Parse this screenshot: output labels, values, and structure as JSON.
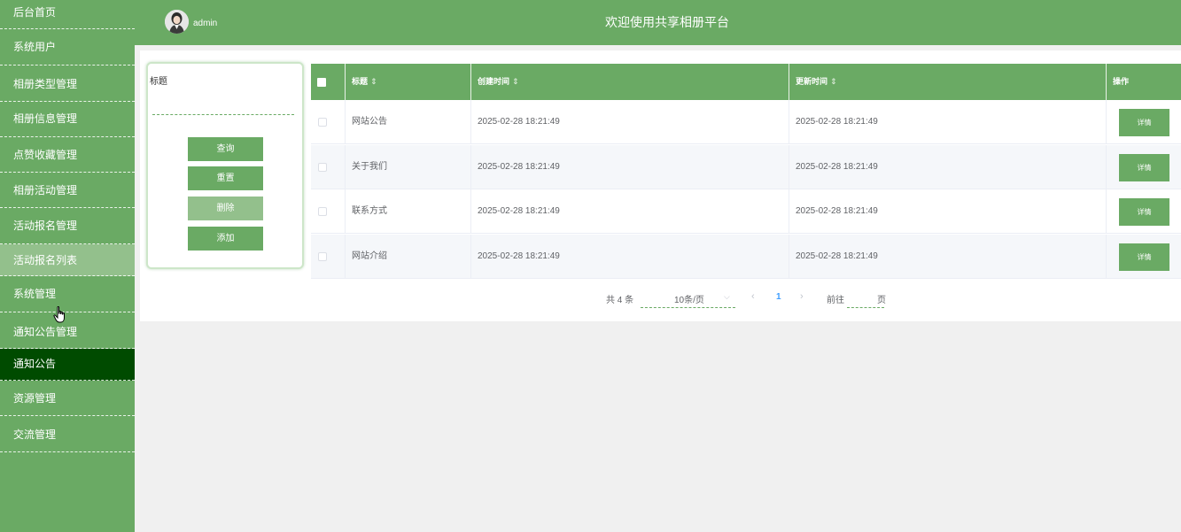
{
  "sidebar": {
    "items": [
      {
        "label": "后台首页"
      },
      {
        "label": "系统用户"
      },
      {
        "label": "相册类型管理"
      },
      {
        "label": "相册信息管理"
      },
      {
        "label": "点赞收藏管理"
      },
      {
        "label": "相册活动管理"
      },
      {
        "label": "活动报名管理"
      },
      {
        "label": "活动报名列表"
      },
      {
        "label": "系统管理"
      },
      {
        "label": "通知公告管理"
      },
      {
        "label": "通知公告"
      },
      {
        "label": "资源管理"
      },
      {
        "label": "交流管理"
      }
    ]
  },
  "header": {
    "username": "admin",
    "title": "欢迎使用共享相册平台"
  },
  "search": {
    "label": "标题",
    "value": "",
    "query_label": "查询",
    "reset_label": "重置",
    "delete_label": "删除",
    "add_label": "添加"
  },
  "table": {
    "columns": {
      "title": "标题",
      "created": "创建时间",
      "updated": "更新时间",
      "action": "操作"
    },
    "sort_icon": "⇕",
    "rows": [
      {
        "title": "网站公告",
        "created": "2025-02-28 18:21:49",
        "updated": "2025-02-28 18:21:49",
        "action": "详情"
      },
      {
        "title": "关于我们",
        "created": "2025-02-28 18:21:49",
        "updated": "2025-02-28 18:21:49",
        "action": "详情"
      },
      {
        "title": "联系方式",
        "created": "2025-02-28 18:21:49",
        "updated": "2025-02-28 18:21:49",
        "action": "详情"
      },
      {
        "title": "网站介绍",
        "created": "2025-02-28 18:21:49",
        "updated": "2025-02-28 18:21:49",
        "action": "详情"
      }
    ]
  },
  "pagination": {
    "total": "共 4 条",
    "page_size": "10条/页",
    "current_page": "1",
    "goto_prefix": "前往",
    "goto_suffix": "页",
    "goto_value": ""
  },
  "colors": {
    "primary": "#6aaa64",
    "primary_light": "#93c08c",
    "active_menu": "#004b00"
  }
}
